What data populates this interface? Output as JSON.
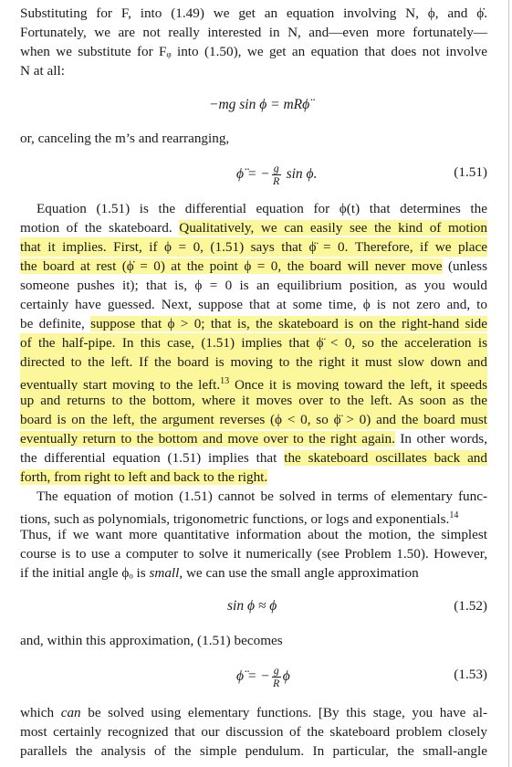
{
  "paragraph_1": [
    "Substituting for F, into (1.49) we get an equation involving N, ϕ, and ϕ̇.",
    "Fortunately, we are not really interested in N, and—even more fortunately—",
    "when we substitute for Fᵩ into (1.50), we get an equation that does not involve",
    "N at all:"
  ],
  "equation_a": "−mg sin ϕ = mRϕ̈",
  "line_cancel": "or, canceling the m’s and rearranging,",
  "equation_1_51": {
    "lhs": "ϕ̈ = −",
    "num": "g",
    "den": "R",
    "rhs": "sin ϕ.",
    "number": "(1.51)"
  },
  "paragraph_2": {
    "l1": "Equation (1.51) is the differential equation for ϕ(t) that determines the",
    "l2_a": "motion of the skateboard. ",
    "l2_b": "Qualitatively, we can easily see the kind of motion",
    "l3_a": "that it implies. First, if ϕ = 0, (1.51) says that ϕ̈ = 0. Therefore, if we place",
    "l4_a": "the board at rest (ϕ̇ = 0) at the point ϕ = 0, the board will never move",
    "l4_b": " (unless",
    "l5": "someone pushes it); that is, ϕ = 0 is an equilibrium position, as you would",
    "l6": "certainly have guessed. Next, suppose that at some time, ϕ is not zero and, to",
    "l7_a": "be definite, ",
    "l7_b": "suppose that ϕ > 0; that is, the skateboard is on the right-hand side",
    "l8": "of the half-pipe. In this case, (1.51) implies that ϕ̈ < 0, so the acceleration is",
    "l9": "directed to the left. If the board is moving to the right it must slow down and",
    "l10_a": "eventually start moving to the left.",
    "l10_fn": "13",
    "l10_b": " Once it is moving toward the left, it speeds",
    "l11": "up and returns to the bottom, where it moves over to the left. As soon as the",
    "l12": "board is on the left, the argument reverses (ϕ < 0, so ϕ̈ > 0) and the board must",
    "l13_a": "eventually return to the bottom and move over to the right again.",
    "l13_b": " In other words,",
    "l14_a": "the differential equation (1.51) implies that ",
    "l14_b": "the skateboard oscillates back and",
    "l15": "forth, from right to left and back to the right."
  },
  "paragraph_3": {
    "l1": "The equation of motion (1.51) cannot be solved in terms of elementary func-",
    "l2_a": "tions, such as polynomials, trigonometric functions, or logs and exponentials.",
    "l2_fn": "14",
    "l3": "Thus, if we want more quantitative information about the motion, the simplest",
    "l4": "course is to use a computer to solve it numerically (see Problem 1.50). However,",
    "l5_a": "if the initial angle ϕₒ is ",
    "l5_em": "small",
    "l5_b": ", we can use the small angle approximation"
  },
  "equation_1_52": {
    "text": "sin ϕ ≈ ϕ",
    "number": "(1.52)"
  },
  "line_within": "and, within this approximation, (1.51) becomes",
  "equation_1_53": {
    "lhs": "ϕ̈ = −",
    "num": "g",
    "den": "R",
    "rhs": "ϕ",
    "number": "(1.53)"
  },
  "paragraph_4": {
    "l1_a": "which ",
    "l1_em": "can",
    "l1_b": " be solved using elementary functions. [By this stage, you have al-",
    "l2": "most certainly recognized that our discussion of the skateboard problem closely",
    "l3": "parallels the analysis of the simple pendulum. In particular, the small-angle"
  }
}
